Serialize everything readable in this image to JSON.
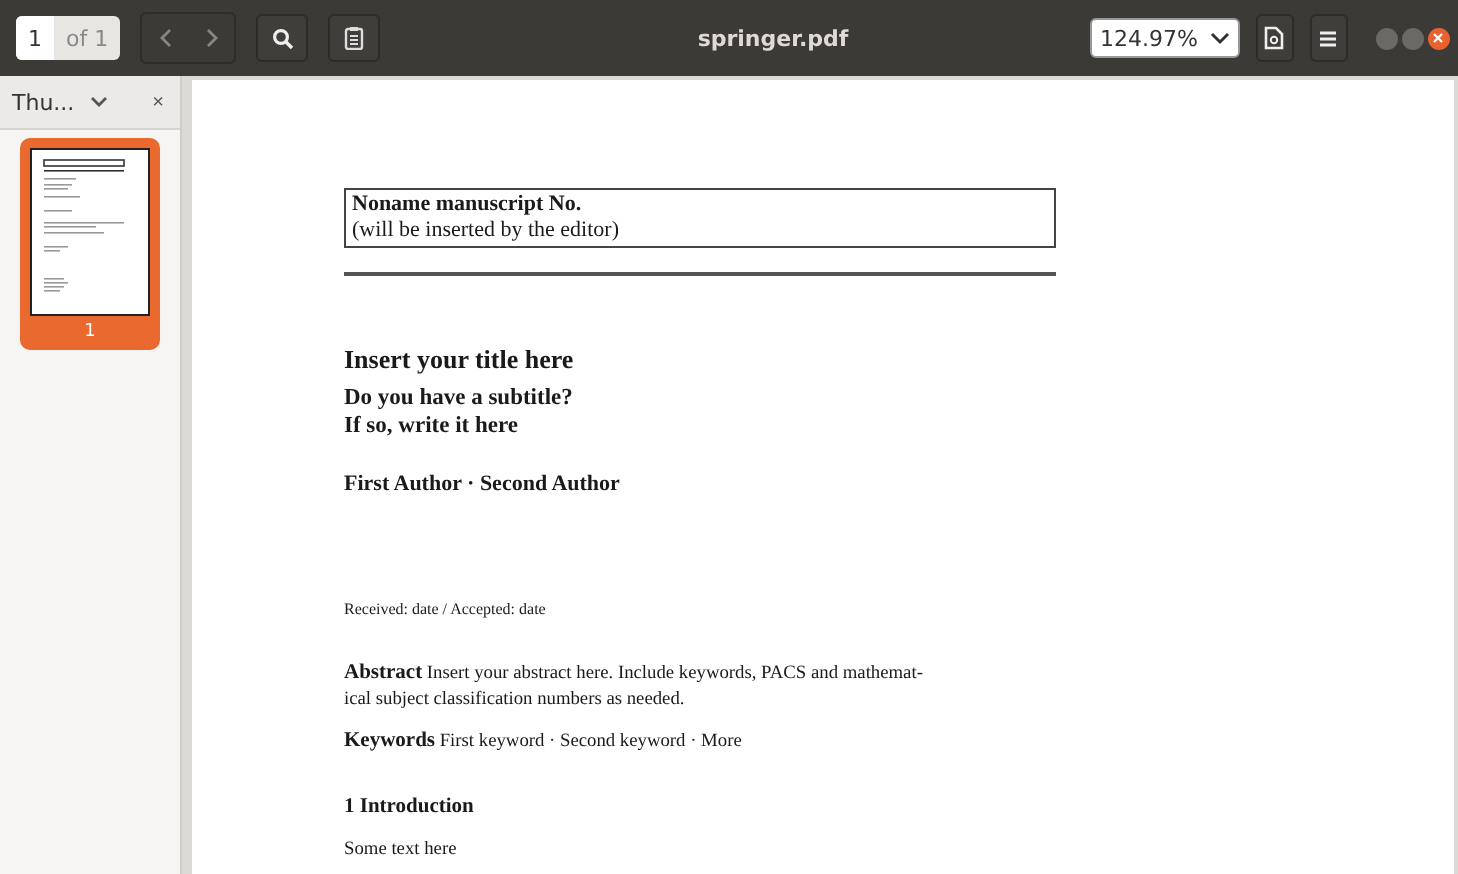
{
  "toolbar": {
    "page_number": "1",
    "page_count": "of 1",
    "title": "springer.pdf",
    "zoom": "124.97%"
  },
  "sidebar": {
    "tab_label": "Thu...",
    "close_glyph": "×",
    "thumbnails": [
      {
        "label": "1",
        "selected": true
      }
    ]
  },
  "document": {
    "header_box": [
      "Noname manuscript No.",
      "(will be inserted by the editor)"
    ],
    "title": "Insert your title here",
    "subtitle_lines": [
      "Do you have a subtitle?",
      "If so, write it here"
    ],
    "authors": "First Author · Second Author",
    "received": "Received: date / Accepted: date",
    "abstract_lines": [
      "**Abstract** Insert your abstract here. Include keywords, PACS and mathemat-",
      "ical subject classification numbers as needed."
    ],
    "keywords": "**Keywords** First keyword · Second keyword · More",
    "section_heading": "1 Introduction",
    "body": "Some text here"
  }
}
